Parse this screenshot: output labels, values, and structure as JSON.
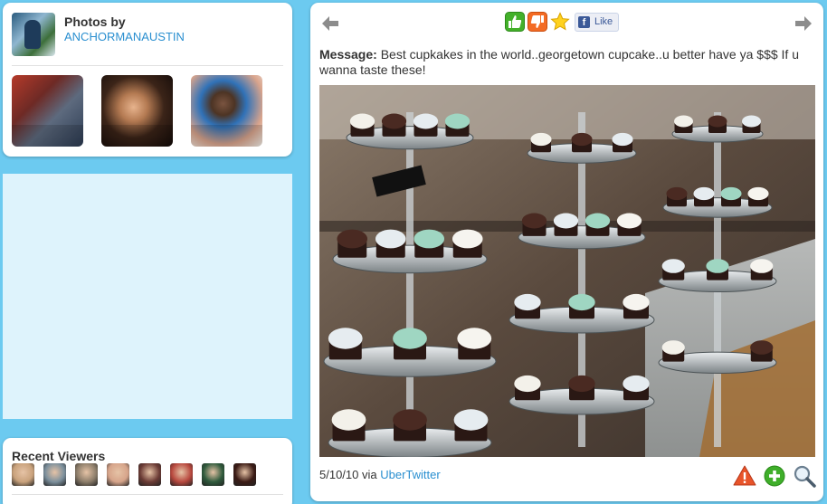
{
  "photos_panel": {
    "title": "Photos by",
    "owner_name": "ANCHORMANAUSTIN",
    "owner_avatar_icon": "user-avatar",
    "thumbnails": [
      {
        "icon": "photo-thumbnail"
      },
      {
        "icon": "photo-thumbnail"
      },
      {
        "icon": "photo-thumbnail"
      }
    ]
  },
  "viewers_panel": {
    "title": "Recent Viewers",
    "viewers": [
      {
        "icon": "viewer-avatar",
        "color": "#c9a27c"
      },
      {
        "icon": "viewer-avatar",
        "color": "#7b8f9c"
      },
      {
        "icon": "viewer-avatar",
        "color": "#8c7d6a"
      },
      {
        "icon": "viewer-avatar",
        "color": "#d6a48a"
      },
      {
        "icon": "viewer-avatar",
        "color": "#6b3b35"
      },
      {
        "icon": "viewer-avatar",
        "color": "#b8483e"
      },
      {
        "icon": "viewer-avatar",
        "color": "#2f5a3c"
      },
      {
        "icon": "viewer-avatar",
        "color": "#3a1a14"
      }
    ]
  },
  "toolbar": {
    "prev_icon": "arrow-left-icon",
    "next_icon": "arrow-right-icon",
    "thumbs_up_icon": "thumbs-up-icon",
    "thumbs_down_icon": "thumbs-down-icon",
    "favorite_icon": "star-icon",
    "like_label": "Like",
    "like_badge": "f"
  },
  "post": {
    "message_label": "Message:",
    "message_text": "Best cupkakes in the world..georgetown cupcake..u better have ya $$$ If u wanna taste these!",
    "date": "5/10/10",
    "via_text": "via",
    "via_app": "UberTwitter",
    "photo_icon": "cupcake-display-photo"
  },
  "bottom_actions": {
    "report_icon": "warning-icon",
    "add_icon": "plus-icon",
    "zoom_icon": "magnifier-icon"
  },
  "colors": {
    "page_background": "#6ccaf0",
    "link": "#2a8fd0",
    "blank_panel": "#def3fc"
  }
}
